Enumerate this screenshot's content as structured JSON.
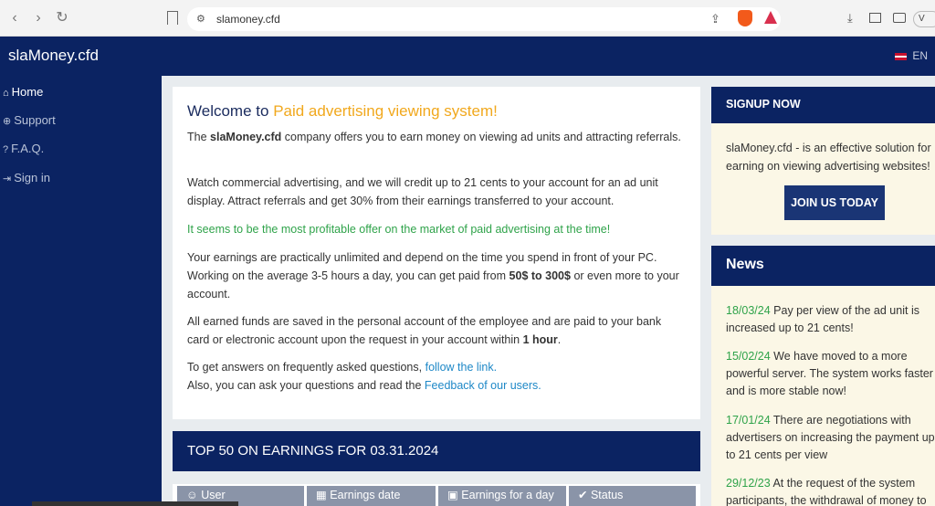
{
  "browser": {
    "url": "slamoney.cfd",
    "profile_label": "V"
  },
  "header": {
    "brand": "slaMoney.cfd",
    "lang": "EN"
  },
  "sidebar": {
    "items": [
      {
        "label": "Home",
        "icon": "home-icon"
      },
      {
        "label": "Support",
        "icon": "globe-icon"
      },
      {
        "label": "F.A.Q.",
        "icon": "question-icon"
      },
      {
        "label": "Sign in",
        "icon": "sign-in-icon"
      }
    ]
  },
  "main": {
    "welcome_prefix": "Welcome to",
    "welcome_highlight": "Paid advertising viewing system!",
    "p1_pre": "The",
    "p1_bold": "slaMoney.cfd",
    "p1_post": "company offers you to earn money on viewing ad units and attracting referrals.",
    "p2": "Watch commercial advertising, and we will credit up to 21 cents to your account for an ad unit display. Attract referrals and get 30% from their earnings transferred to your account.",
    "p3": "It seems to be the most profitable offer on the market of paid advertising at the time!",
    "p4_pre": "Your earnings are practically unlimited and depend on the time you spend in front of your PC. Working on the average 3-5 hours a day, you can get paid from",
    "p4_bold": "50$ to 300$",
    "p4_post": "or even more to your account.",
    "p5_pre": "All earned funds are saved in the personal account of the employee and are paid to your bank card or electronic account upon the request in your account within",
    "p5_bold": "1 hour",
    "p5_post": ".",
    "p6_pre": "To get answers on frequently asked questions,",
    "p6_link": "follow the link.",
    "p7_pre": "Also, you can ask your questions and read the",
    "p7_link": "Feedback of our users."
  },
  "top50": {
    "title": "TOP 50 ON EARNINGS FOR 03.31.2024",
    "columns": [
      "User",
      "Earnings date",
      "Earnings for a day",
      "Status"
    ]
  },
  "signup": {
    "title": "SIGNUP NOW",
    "text": "slaMoney.cfd - is an effective solution for earning on viewing advertising websites!",
    "button": "JOIN US TODAY"
  },
  "news": {
    "title": "News",
    "items": [
      {
        "date": "18/03/24",
        "text": "Pay per view of the ad unit is increased up to 21 cents!"
      },
      {
        "date": "15/02/24",
        "text": "We have moved to a more powerful server. The system works faster and is more stable now!"
      },
      {
        "date": "17/01/24",
        "text": "There are negotiations with advertisers on increasing the payment up to 21 cents per view"
      },
      {
        "date": "29/12/23",
        "text": "At the request of the system participants, the withdrawal of money to"
      }
    ]
  }
}
